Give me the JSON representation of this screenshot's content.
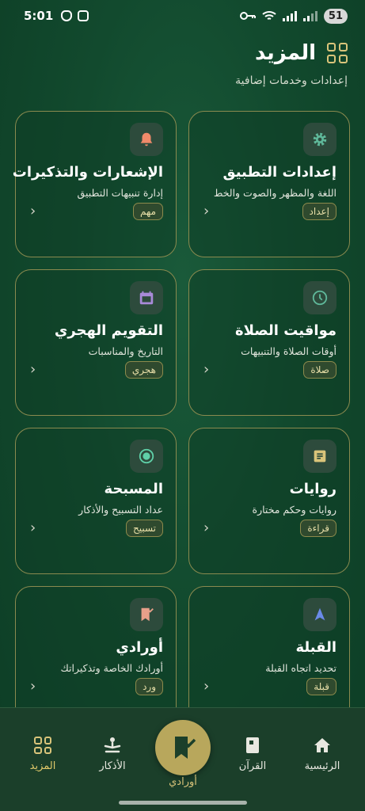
{
  "status": {
    "time": "5:01",
    "battery": "51"
  },
  "header": {
    "title": "المزيد",
    "subtitle": "إعدادات وخدمات إضافية"
  },
  "cards": [
    {
      "title": "إعدادات التطبيق",
      "desc": "اللغة والمظهر والصوت والخط",
      "badge": "إعداد",
      "icon": "gear-icon",
      "color": "#5fb89a"
    },
    {
      "title": "الإشعارات والتذكيرات",
      "desc": "إدارة تنبيهات التطبيق",
      "badge": "مهم",
      "icon": "bell-icon",
      "color": "#f08a6a"
    },
    {
      "title": "مواقيت الصلاة",
      "desc": "أوقات الصلاة والتنبيهات",
      "badge": "صلاة",
      "icon": "clock-icon",
      "color": "#5fb89a"
    },
    {
      "title": "التقويم الهجري",
      "desc": "التاريخ والمناسبات",
      "badge": "هجري",
      "icon": "calendar-icon",
      "color": "#a88ad8"
    },
    {
      "title": "روايات",
      "desc": "روايات وحكم مختارة",
      "badge": "قراءة",
      "icon": "article-icon",
      "color": "#d9c47a"
    },
    {
      "title": "المسبحة",
      "desc": "عداد التسبيح والأذكار",
      "badge": "تسبيح",
      "icon": "radio-dot-icon",
      "color": "#5fd0a8"
    },
    {
      "title": "القبلة",
      "desc": "تحديد اتجاه القبلة",
      "badge": "قبلة",
      "icon": "navigation-arrow-icon",
      "color": "#6a8ae8"
    },
    {
      "title": "أورادي",
      "desc": "أورادك الخاصة وتذكيراتك",
      "badge": "ورد",
      "icon": "bookmark-check-icon",
      "color": "#e8a08a"
    }
  ],
  "nav": {
    "home": "الرئيسية",
    "quran": "القرآن",
    "center": "أورادي",
    "adhkar": "الأذكار",
    "more": "المزيد"
  },
  "colors": {
    "accent": "#d9c47a",
    "background": "#124a2e",
    "card_border": "#8a8a4f"
  }
}
